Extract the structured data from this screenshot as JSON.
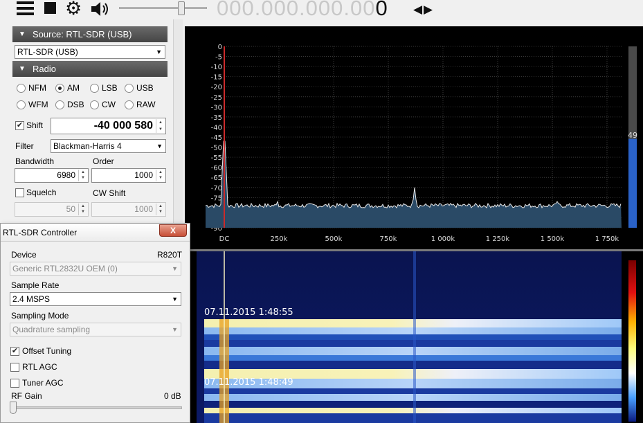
{
  "toolbar": {
    "frequency_dim": "000.000.000.00",
    "frequency_last": "0",
    "menu_icon": "hamburger-menu-icon",
    "stop_icon": "stop-icon",
    "gear_icon": "gear-icon",
    "volume_icon": "speaker-icon",
    "volume_level": 0.72
  },
  "source_panel": {
    "header": "Source: RTL-SDR (USB)",
    "selected": "RTL-SDR (USB)"
  },
  "radio_panel": {
    "header": "Radio",
    "modes": [
      "NFM",
      "AM",
      "LSB",
      "USB",
      "WFM",
      "DSB",
      "CW",
      "RAW"
    ],
    "selected_mode": "AM",
    "shift_label": "Shift",
    "shift_checked": true,
    "shift_value": "-40 000 580",
    "filter_label": "Filter",
    "filter_value": "Blackman-Harris 4",
    "bandwidth_label": "Bandwidth",
    "bandwidth_value": "6980",
    "order_label": "Order",
    "order_value": "1000",
    "squelch_label": "Squelch",
    "squelch_checked": false,
    "squelch_value": "50",
    "cwshift_label": "CW Shift",
    "cwshift_value": "1000"
  },
  "controller": {
    "title": "RTL-SDR Controller",
    "close_label": "X",
    "device_label": "Device",
    "tuner_type": "R820T",
    "device_value": "Generic RTL2832U OEM (0)",
    "sample_rate_label": "Sample Rate",
    "sample_rate_value": "2.4 MSPS",
    "sampling_mode_label": "Sampling Mode",
    "sampling_mode_value": "Quadrature sampling",
    "offset_tuning_label": "Offset Tuning",
    "offset_tuning_checked": true,
    "rtl_agc_label": "RTL AGC",
    "rtl_agc_checked": false,
    "tuner_agc_label": "Tuner AGC",
    "tuner_agc_checked": false,
    "rf_gain_label": "RF Gain",
    "rf_gain_value": "0 dB",
    "rf_gain_level": 0
  },
  "spectrum": {
    "y_ticks": [
      "0",
      "-5",
      "-10",
      "-15",
      "-20",
      "-25",
      "-30",
      "-35",
      "-40",
      "-45",
      "-50",
      "-55",
      "-60",
      "-65",
      "-70",
      "-75",
      "-80",
      "-85",
      "-90"
    ],
    "x_ticks": [
      "DC",
      "250k",
      "500k",
      "750k",
      "1 000k",
      "1 250k",
      "1 500k",
      "1 750k"
    ],
    "noise_floor_db": -79,
    "dc_peak_db": -47,
    "peak_db": -70,
    "level_readout": "49",
    "level_fill": 0.49,
    "colors": {
      "fill": "#2a4a66",
      "bar": "#2a62c8",
      "marker": "#cc2a2a"
    }
  },
  "waterfall": {
    "timestamps": [
      "07.11.2015 1:48:55",
      "07.11.2015 1:48:49"
    ]
  }
}
